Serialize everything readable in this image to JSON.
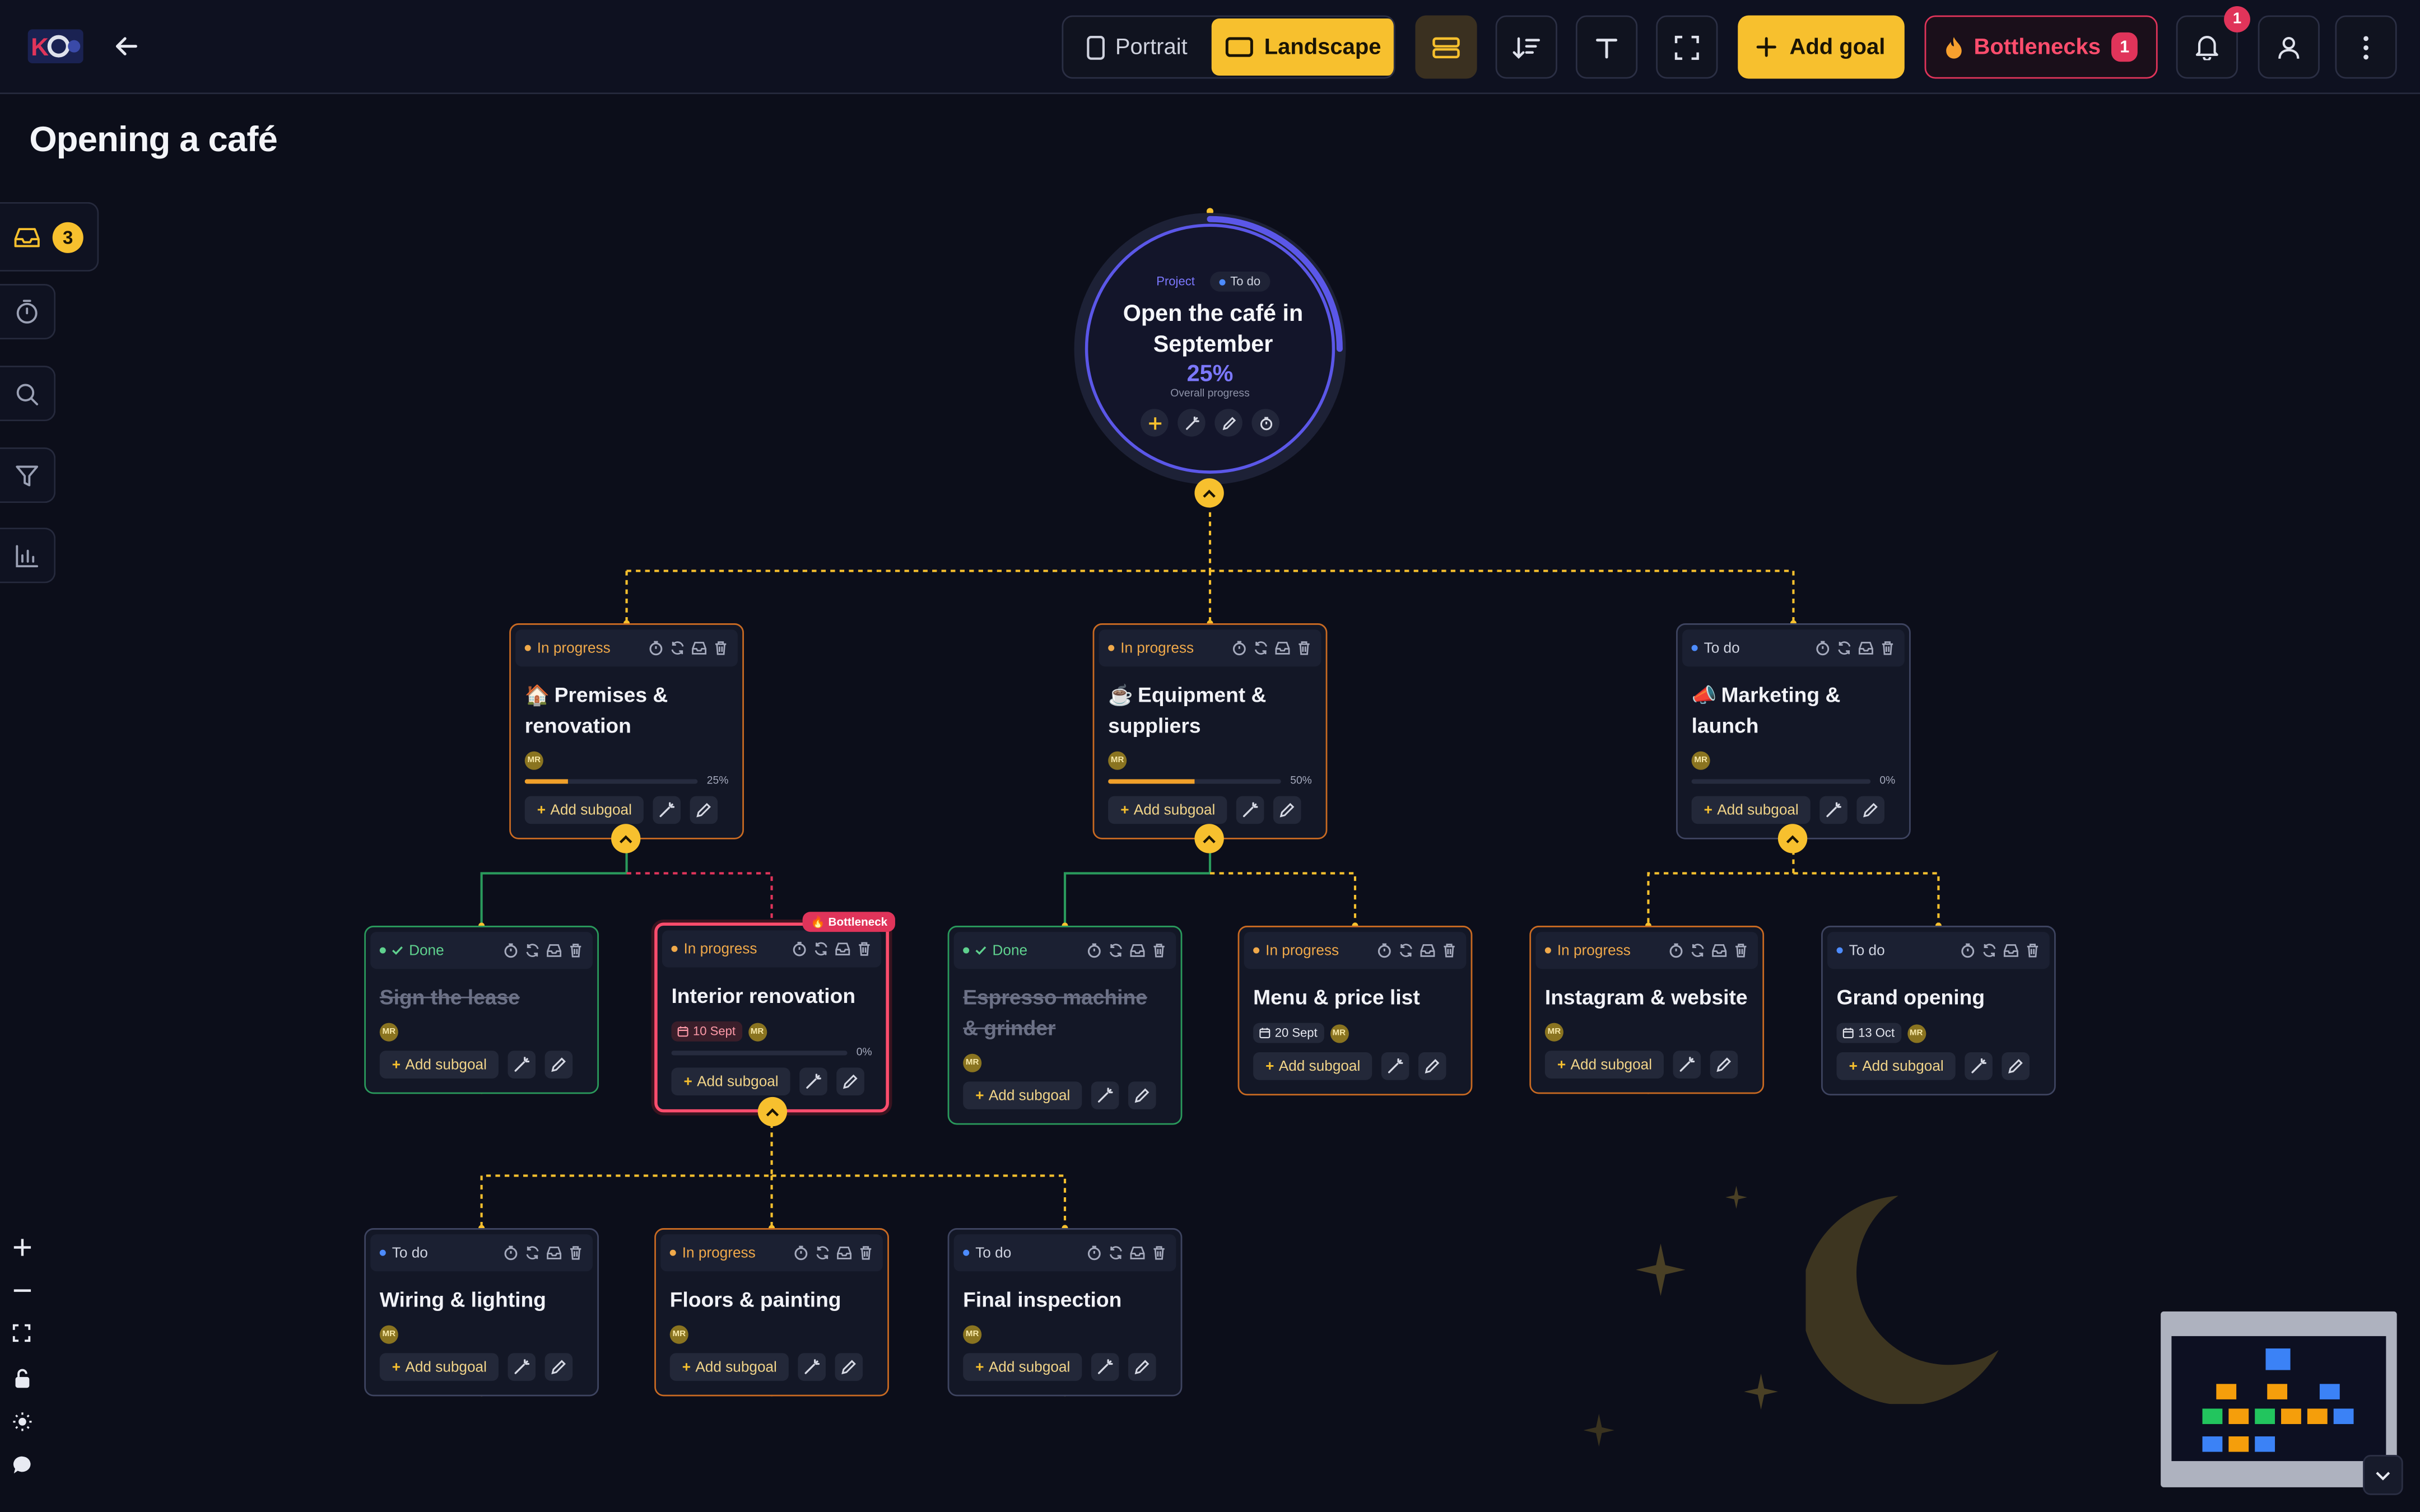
{
  "header": {
    "back_label": "Back",
    "orientation": {
      "portrait": "Portrait",
      "landscape": "Landscape",
      "selected": "Landscape"
    },
    "add_goal": "Add goal",
    "bottlenecks": {
      "label": "Bottlenecks",
      "count": "1"
    },
    "notifications_count": "1"
  },
  "page": {
    "title": "Opening a café"
  },
  "sidebar": {
    "inbox_count": "3"
  },
  "root": {
    "type_label": "Project",
    "status": "To do",
    "title": "Open the café in September",
    "progress": "25%",
    "progress_label": "Overall progress",
    "progress_value": 25
  },
  "card_labels": {
    "add_subgoal": "Add subgoal",
    "bottleneck": "Bottleneck",
    "avatar": "MR"
  },
  "cards": {
    "premises": {
      "status": "In progress",
      "emoji": "🏠",
      "title": "Premises & renovation",
      "progress": "25%",
      "progress_value": 25
    },
    "equipment": {
      "status": "In progress",
      "emoji": "☕",
      "title": "Equipment & suppliers",
      "progress": "50%",
      "progress_value": 50
    },
    "marketing": {
      "status": "To do",
      "emoji": "📣",
      "title": "Marketing & launch",
      "progress": "0%",
      "progress_value": 0
    },
    "lease": {
      "status": "Done",
      "title": "Sign the lease"
    },
    "interior": {
      "status": "In progress",
      "title": "Interior renovation",
      "due": "10 Sept",
      "progress": "0%",
      "progress_value": 0
    },
    "espresso": {
      "status": "Done",
      "title": "Espresso machine & grinder"
    },
    "menu": {
      "status": "In progress",
      "title": "Menu & price list",
      "due": "20 Sept"
    },
    "instagram": {
      "status": "In progress",
      "title": "Instagram & website"
    },
    "grand": {
      "status": "To do",
      "title": "Grand opening",
      "due": "13 Oct"
    },
    "wiring": {
      "status": "To do",
      "title": "Wiring & lighting"
    },
    "floors": {
      "status": "In progress",
      "title": "Floors & painting"
    },
    "inspection": {
      "status": "To do",
      "title": "Final inspection"
    }
  },
  "colors": {
    "accent": "#f7c02e",
    "in_progress": "#c96a22",
    "done": "#2a9a5c",
    "todo": "#4d8cff",
    "bottleneck": "#e0345a",
    "project": "#5b57e8"
  }
}
